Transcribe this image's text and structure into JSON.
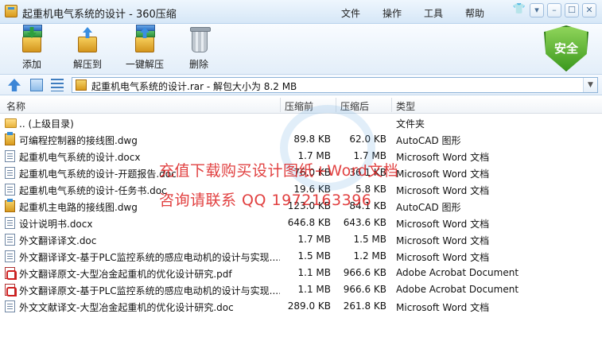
{
  "window": {
    "title": "起重机电气系统的设计 - 360压缩",
    "menu": [
      "文件",
      "操作",
      "工具",
      "帮助"
    ],
    "controls": {
      "minimize": "–",
      "maximize": "☐",
      "close": "✕"
    }
  },
  "toolbar": {
    "add_label": "添加",
    "extract_label": "解压到",
    "one_click_label": "一键解压",
    "delete_label": "删除",
    "security_label": "安全"
  },
  "address": {
    "text": "起重机电气系统的设计.rar - 解包大小为 8.2 MB"
  },
  "columns": {
    "name": "名称",
    "packed": "压缩前",
    "size": "压缩后",
    "type": "类型"
  },
  "rows": [
    {
      "icon": "folder-icon",
      "name": ".. (上级目录)",
      "packed": "",
      "size": "",
      "type": "文件夹"
    },
    {
      "icon": "dwg-file-icon",
      "name": "可编程控制器的接线图.dwg",
      "packed": "89.8 KB",
      "size": "62.0 KB",
      "type": "AutoCAD 图形"
    },
    {
      "icon": "word-doc-icon",
      "name": "起重机电气系统的设计.docx",
      "packed": "1.7 MB",
      "size": "1.7 MB",
      "type": "Microsoft Word 文档"
    },
    {
      "icon": "word-doc-icon",
      "name": "起重机电气系统的设计-开题报告.doc",
      "packed": "76.0 KB",
      "size": "36.1 KB",
      "type": "Microsoft Word 文档"
    },
    {
      "icon": "word-doc-icon",
      "name": "起重机电气系统的设计-任务书.doc",
      "packed": "19.6 KB",
      "size": "5.8 KB",
      "type": "Microsoft Word 文档"
    },
    {
      "icon": "dwg-file-icon",
      "name": "起重机主电路的接线图.dwg",
      "packed": "123.0 KB",
      "size": "84.1 KB",
      "type": "AutoCAD 图形"
    },
    {
      "icon": "word-doc-icon",
      "name": "设计说明书.docx",
      "packed": "646.8 KB",
      "size": "643.6 KB",
      "type": "Microsoft Word 文档"
    },
    {
      "icon": "word-doc-icon",
      "name": "外文翻译译文.doc",
      "packed": "1.7 MB",
      "size": "1.5 MB",
      "type": "Microsoft Word 文档"
    },
    {
      "icon": "word-doc-icon",
      "name": "外文翻译译文-基于PLC监控系统的感应电动机的设计与实现....",
      "packed": "1.5 MB",
      "size": "1.2 MB",
      "type": "Microsoft Word 文档"
    },
    {
      "icon": "pdf-file-icon",
      "name": "外文翻译原文-大型冶金起重机的优化设计研究.pdf",
      "packed": "1.1 MB",
      "size": "966.6 KB",
      "type": "Adobe Acrobat Document"
    },
    {
      "icon": "pdf-file-icon",
      "name": "外文翻译原文-基于PLC监控系统的感应电动机的设计与实现....",
      "packed": "1.1 MB",
      "size": "966.6 KB",
      "type": "Adobe Acrobat Document"
    },
    {
      "icon": "word-doc-icon",
      "name": "外文文献译文-大型冶金起重机的优化设计研究.doc",
      "packed": "289.0 KB",
      "size": "261.8 KB",
      "type": "Microsoft Word 文档"
    }
  ],
  "watermark": {
    "line1": "充值下载购买设计图纸+Word文档",
    "line2": "咨询请联系  QQ 1972163396"
  }
}
